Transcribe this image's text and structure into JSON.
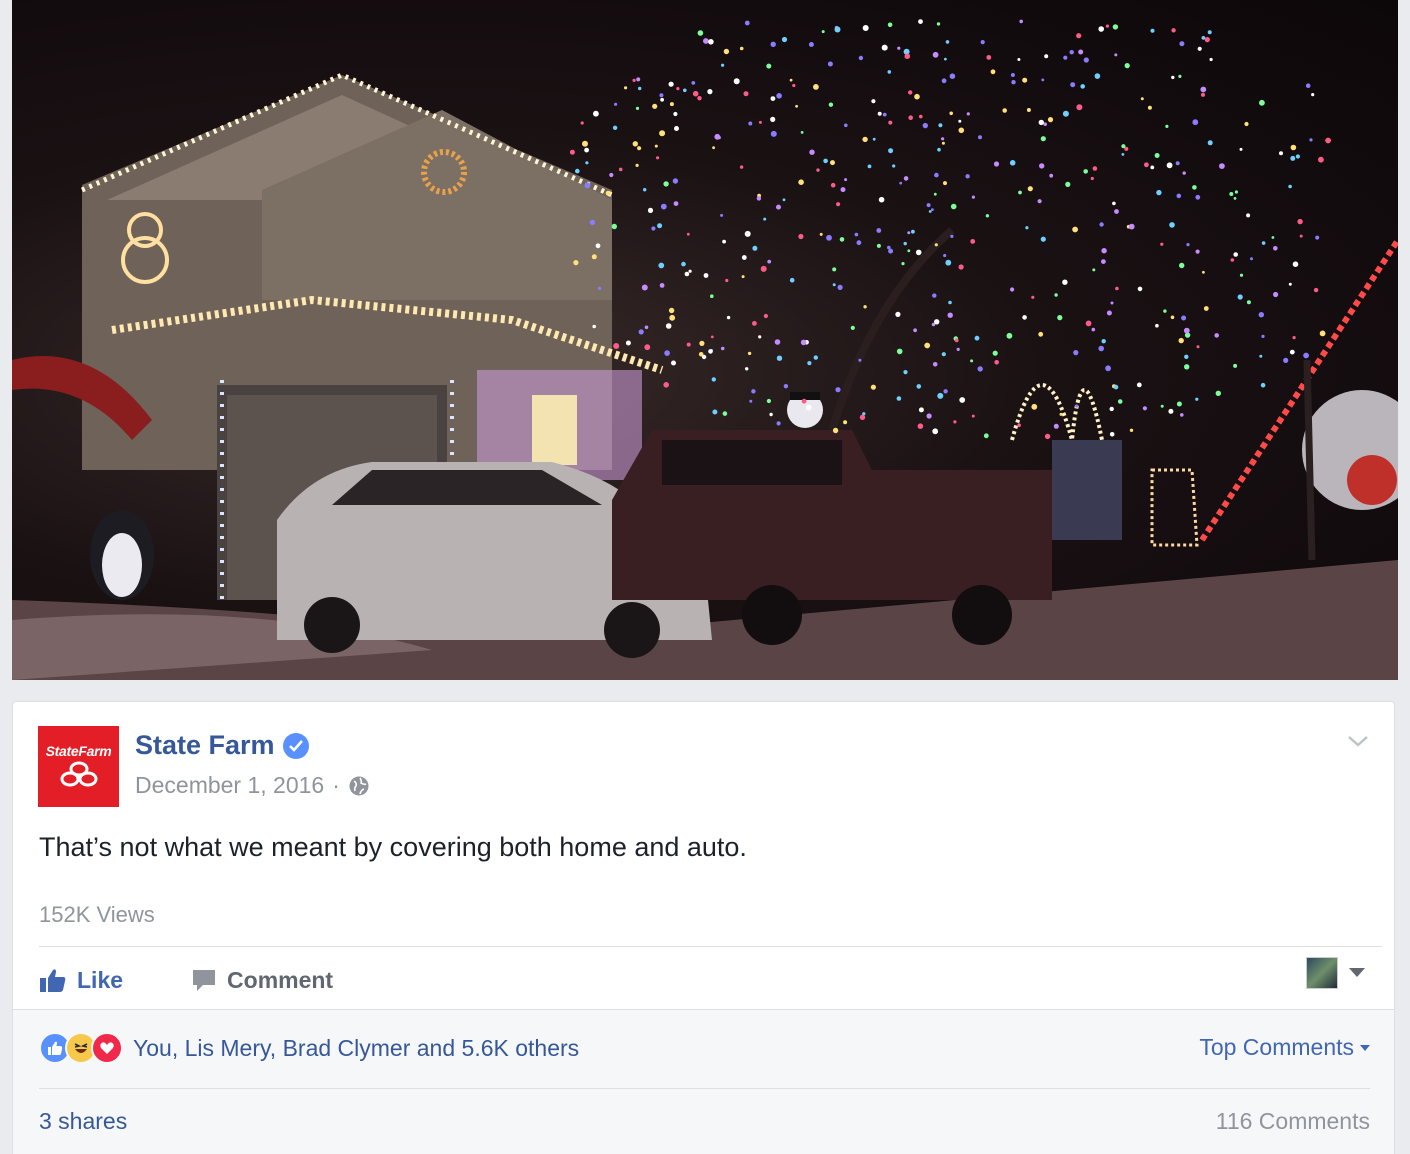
{
  "video": {
    "description_icon": "video-thumbnail"
  },
  "post": {
    "page_name": "State Farm",
    "avatar_brand": "StateFarm",
    "date": "December 1, 2016",
    "separator": "·",
    "audience_icon": "globe-icon",
    "text": "That’s not what we meant by covering both home and auto.",
    "views": "152K Views"
  },
  "actions": {
    "like_label": "Like",
    "comment_label": "Comment"
  },
  "feedback": {
    "reactors": "You, Lis Mery, Brad Clymer and 5.6K others",
    "top_comments_label": "Top Comments",
    "shares": "3 shares",
    "comments_count": "116 Comments"
  },
  "colors": {
    "link_blue": "#365899",
    "fb_blue": "#4267b2",
    "brand_red": "#e41e26",
    "muted_gray": "#90949c"
  }
}
